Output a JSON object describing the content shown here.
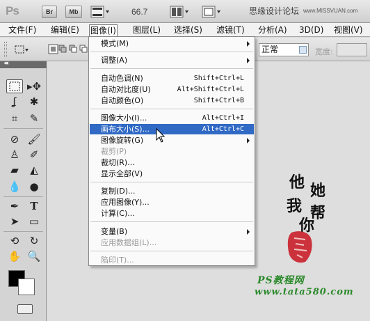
{
  "app": {
    "logo": "Ps",
    "bridge_label": "Br",
    "minibridge_label": "Mb",
    "zoom": "66.7",
    "site_title": "思缘设计论坛",
    "site_url": "www.MISSVUAN.com"
  },
  "menubar": {
    "items": [
      {
        "label": "文件(F)"
      },
      {
        "label": "编辑(E)"
      },
      {
        "label": "图像(I)"
      },
      {
        "label": "图层(L)"
      },
      {
        "label": "选择(S)"
      },
      {
        "label": "滤镜(T)"
      },
      {
        "label": "分析(A)"
      },
      {
        "label": "3D(D)"
      },
      {
        "label": "视图(V)"
      }
    ]
  },
  "options": {
    "style_value": "正常",
    "width_label": "宽度:"
  },
  "image_menu": {
    "items": [
      {
        "label": "模式(M)",
        "shortcut": "",
        "submenu": true
      },
      {
        "label": "调整(A)",
        "shortcut": "",
        "submenu": true
      },
      {
        "label": "自动色调(N)",
        "shortcut": "Shift+Ctrl+L"
      },
      {
        "label": "自动对比度(U)",
        "shortcut": "Alt+Shift+Ctrl+L"
      },
      {
        "label": "自动颜色(O)",
        "shortcut": "Shift+Ctrl+B"
      },
      {
        "label": "图像大小(I)...",
        "shortcut": "Alt+Ctrl+I"
      },
      {
        "label": "画布大小(S)...",
        "shortcut": "Alt+Ctrl+C",
        "highlighted": true
      },
      {
        "label": "图像旋转(G)",
        "shortcut": "",
        "submenu": true
      },
      {
        "label": "裁剪(P)",
        "shortcut": "",
        "disabled": true
      },
      {
        "label": "裁切(R)...",
        "shortcut": ""
      },
      {
        "label": "显示全部(V)",
        "shortcut": ""
      },
      {
        "label": "复制(D)...",
        "shortcut": ""
      },
      {
        "label": "应用图像(Y)...",
        "shortcut": ""
      },
      {
        "label": "计算(C)...",
        "shortcut": ""
      },
      {
        "label": "变量(B)",
        "shortcut": "",
        "submenu": true
      },
      {
        "label": "应用数据组(L)...",
        "shortcut": "",
        "disabled": true
      },
      {
        "label": "陷印(T)...",
        "shortcut": "",
        "disabled": true
      }
    ]
  },
  "watermark": {
    "calligraphy": [
      "他",
      "她",
      "我",
      "帮",
      "你"
    ],
    "brand": "PS教程网",
    "url": "www.tata580.com"
  },
  "colors": {
    "highlight": "#316ac5",
    "brand_green": "#2b8a2b",
    "stamp_red": "#c8141e"
  }
}
